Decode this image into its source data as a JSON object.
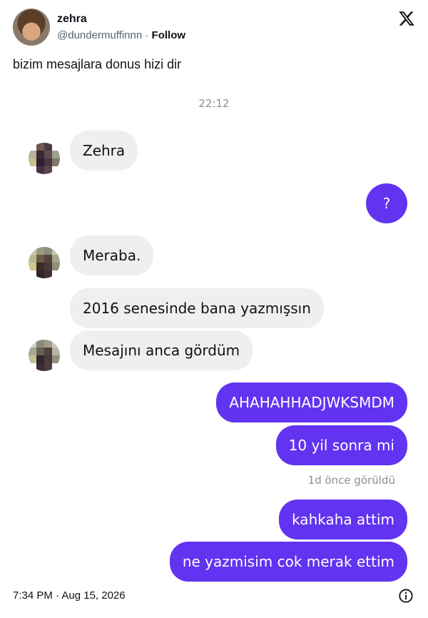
{
  "tweet": {
    "display_name": "zehra",
    "handle": "@dundermuffinnn",
    "separator": "·",
    "follow_label": "Follow",
    "text": "bizim mesajlara donus hizi dir",
    "timestamp": "7:34 PM · Aug 15, 2026"
  },
  "chat": {
    "time_divider": "22:12",
    "messages": [
      {
        "from": "them",
        "text": "Zehra"
      },
      {
        "from": "me",
        "text": "?"
      },
      {
        "from": "them",
        "text": "Meraba."
      },
      {
        "from": "them",
        "text": "2016 senesinde bana yazmışsın"
      },
      {
        "from": "them",
        "text": "Mesajını anca gördüm"
      },
      {
        "from": "me",
        "text": "AHAHAHHADJWKSMDM"
      },
      {
        "from": "me",
        "text": "10 yil sonra mi"
      },
      {
        "from": "me",
        "text": "kahkaha attim"
      },
      {
        "from": "me",
        "text": "ne yazmisim cok merak ettim"
      }
    ],
    "seen_label": "1d önce görüldü"
  },
  "colors": {
    "outgoing_bubble": "#6233f0",
    "incoming_bubble": "#efefef",
    "meta_text": "#8e8e8e",
    "handle_text": "#536471"
  },
  "icons": [
    "x-logo-icon",
    "info-icon"
  ]
}
